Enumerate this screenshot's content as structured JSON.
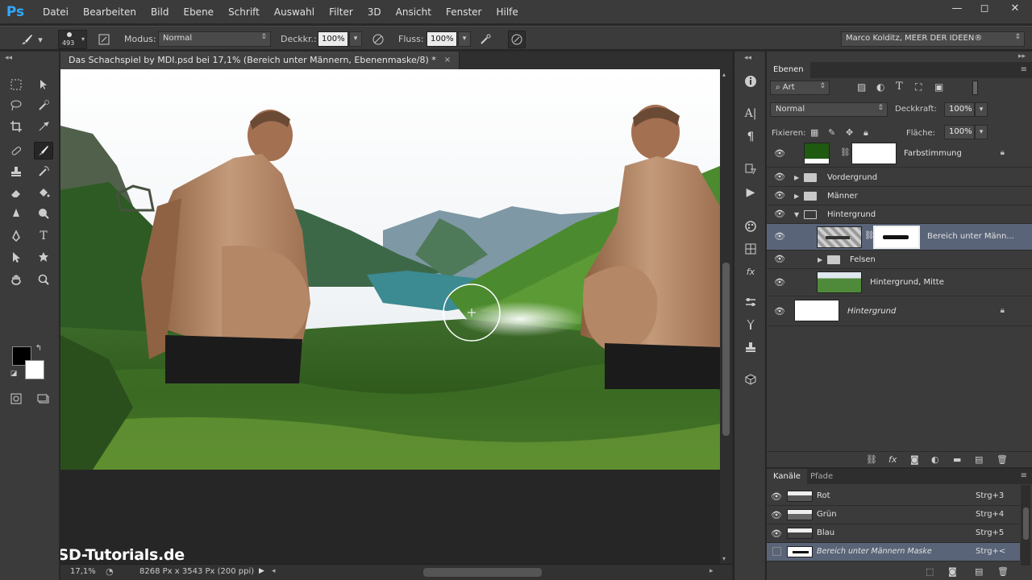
{
  "app": {
    "logo": "Ps"
  },
  "menu": [
    "Datei",
    "Bearbeiten",
    "Bild",
    "Ebene",
    "Schrift",
    "Auswahl",
    "Filter",
    "3D",
    "Ansicht",
    "Fenster",
    "Hilfe"
  ],
  "window_controls": {
    "minimize": "—",
    "maximize": "◻",
    "close": "✕"
  },
  "options": {
    "brush_size": "493",
    "modus_label": "Modus:",
    "modus_value": "Normal",
    "deckkraft_label": "Deckkr.:",
    "deckkraft_value": "100%",
    "fluss_label": "Fluss:",
    "fluss_value": "100%",
    "workspace": "Marco Kolditz, MEER DER IDEEN®"
  },
  "document": {
    "tab_title": "Das Schachspiel by MDI.psd bei 17,1% (Bereich unter Männern, Ebenenmaske/8) *",
    "close": "×"
  },
  "status": {
    "zoom": "17,1%",
    "info": "8268 Px x 3543 Px (200 ppi)"
  },
  "watermark": "PSD-Tutorials.de",
  "layers_panel": {
    "tab": "Ebenen",
    "filter": "Art",
    "blend_mode": "Normal",
    "opacity_label": "Deckkraft:",
    "opacity_value": "100%",
    "lock_label": "Fixieren:",
    "fill_label": "Fläche:",
    "fill_value": "100%",
    "layers": [
      {
        "name": "Farbstimmung",
        "type": "adjustment",
        "thumb_color": "#1f5a10",
        "locked": true
      },
      {
        "name": "Vordergrund",
        "type": "group",
        "expanded": false
      },
      {
        "name": "Männer",
        "type": "group",
        "expanded": false
      },
      {
        "name": "Hintergrund",
        "type": "group",
        "expanded": true
      },
      {
        "name": "Bereich unter Männ...",
        "type": "masked",
        "selected": true
      },
      {
        "name": "Felsen",
        "type": "group",
        "expanded": false
      },
      {
        "name": "Hintergrund, Mitte",
        "type": "image"
      },
      {
        "name": "Hintergrund",
        "type": "background",
        "locked": true
      }
    ]
  },
  "channels_panel": {
    "tabs": [
      "Kanäle",
      "Pfade"
    ],
    "channels": [
      {
        "name": "Rot",
        "shortcut": "Strg+3"
      },
      {
        "name": "Grün",
        "shortcut": "Strg+4"
      },
      {
        "name": "Blau",
        "shortcut": "Strg+5"
      },
      {
        "name": "Bereich unter Männern Maske",
        "shortcut": "Strg+<",
        "selected": true
      }
    ]
  },
  "colors": {
    "accent": "#31a8ff",
    "selected_row": "#596478",
    "panel": "#3b3b3b",
    "canvas_bg": "#262626"
  }
}
